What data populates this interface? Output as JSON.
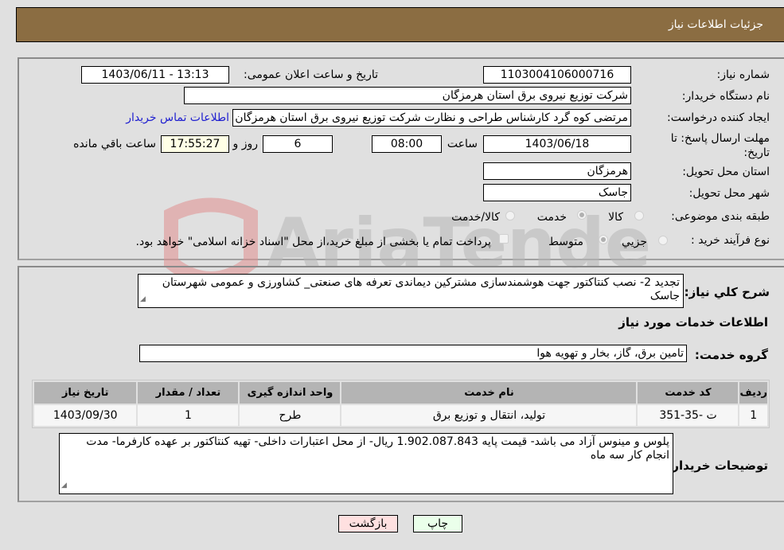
{
  "header": {
    "title": "جزئیات اطلاعات نیاز"
  },
  "form": {
    "need_number": {
      "label": "شماره نیاز:",
      "value": "1103004106000716"
    },
    "announce_datetime": {
      "label": "تاریخ و ساعت اعلان عمومی:",
      "value": "1403/06/11 - 13:13"
    },
    "buyer_org": {
      "label": "نام دستگاه خریدار:",
      "value": "شرکت توزیع نیروی برق استان هرمزگان"
    },
    "requester": {
      "label": "ایجاد کننده درخواست:",
      "value": "مرتضی کوه گرد کارشناس طراحی و نظارت شرکت توزیع نیروی برق استان هرمزگان",
      "contact_link": "اطلاعات تماس خریدار"
    },
    "deadline": {
      "label": "مهلت ارسال پاسخ: تا تاریخ:",
      "date": "1403/06/18",
      "time_label": "ساعت",
      "time": "08:00",
      "days": "6",
      "days_label": "روز و",
      "remaining": "17:55:27",
      "remaining_label": "ساعت باقي مانده"
    },
    "province": {
      "label": "استان محل تحویل:",
      "value": "هرمزگان"
    },
    "city": {
      "label": "شهر محل تحویل:",
      "value": "جاسک"
    },
    "category": {
      "label": "طبقه بندی موضوعی:",
      "options": [
        "کالا",
        "خدمت",
        "کالا/خدمت"
      ],
      "selected": "خدمت"
    },
    "purchase_type": {
      "label": "نوع فرآیند خرید :",
      "options": [
        "جزیي",
        "متوسط"
      ],
      "selected": "متوسط",
      "treasury_note": "پرداخت تمام یا بخشی از مبلغ خرید،از محل \"اسناد خزانه اسلامی\" خواهد بود."
    }
  },
  "description": {
    "label": "شرح کلي نياز:",
    "value": "تجدید 2- نصب کنتاکتور جهت هوشمندسازی مشترکین دیماندی تعرفه های صنعتی_ کشاورزی و عمومی شهرستان جاسک"
  },
  "services_section": {
    "title": "اطلاعات خدمات مورد نیاز",
    "group_label": "گروه خدمت:",
    "group_value": "تامین برق، گاز، بخار و تهویه هوا",
    "table": {
      "headers": [
        "ردیف",
        "کد خدمت",
        "نام خدمت",
        "واحد اندازه گیری",
        "تعداد / مقدار",
        "تاریخ نیاز"
      ],
      "rows": [
        [
          "1",
          "ت -35-351",
          "تولید، انتقال و توزیع برق",
          "طرح",
          "1",
          "1403/09/30"
        ]
      ]
    }
  },
  "buyer_notes": {
    "label": "توضیحات خریدار:",
    "value": "پلوس و مینوس آزاد می باشد- قیمت پایه   1.902.087.843 ریال- از محل اعتبارات داخلی- تهیه کنتاکتور بر عهده کارفرما- مدت انجام کار سه ماه"
  },
  "buttons": {
    "print": "چاپ",
    "back": "بازگشت"
  },
  "colors": {
    "header_bg": "#8b6d42",
    "back_btn_bg": "#ffe0e0",
    "print_btn_bg": "#eaffea",
    "link": "#2020d0"
  }
}
